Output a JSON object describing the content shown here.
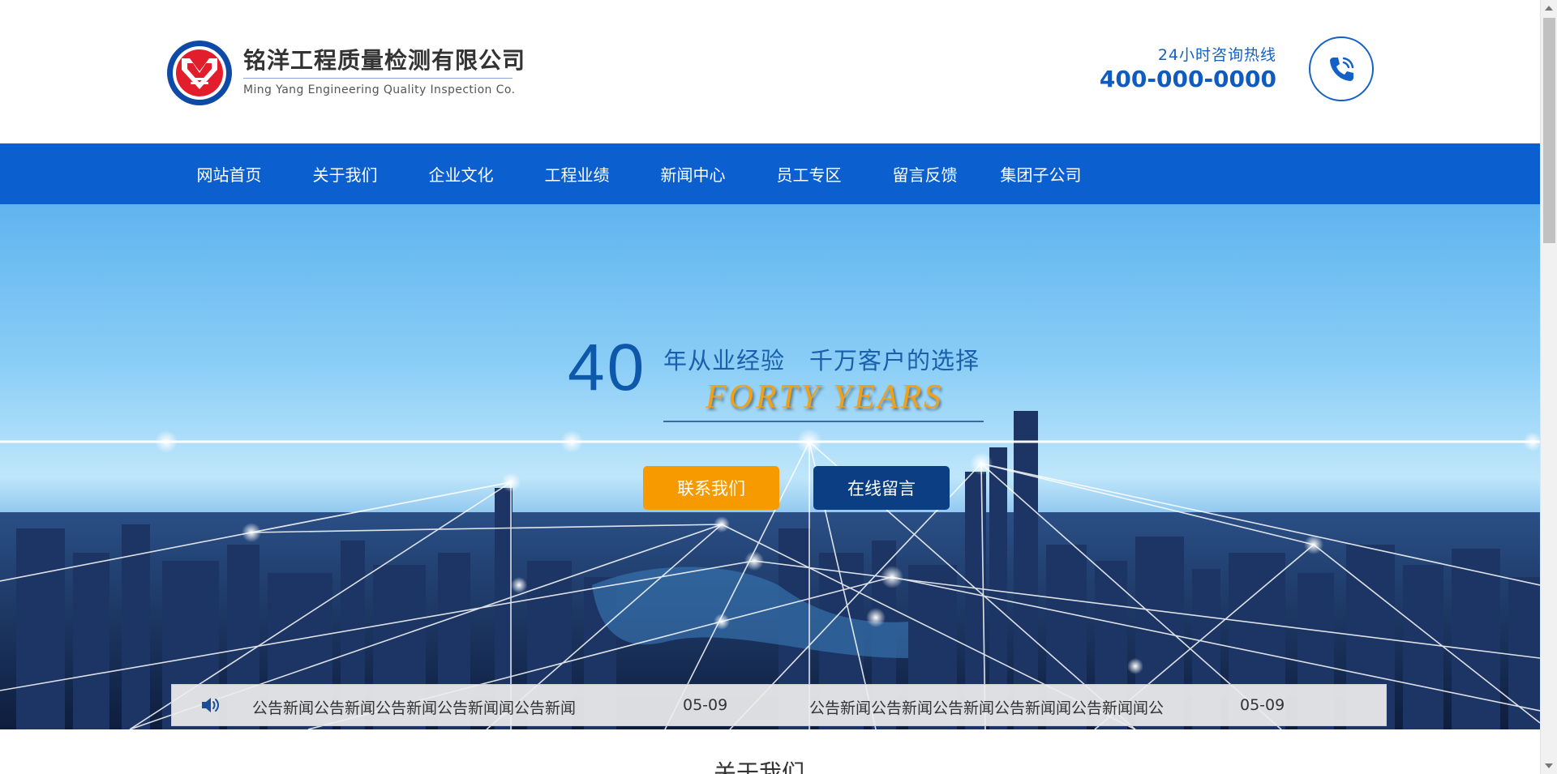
{
  "header": {
    "company_name": "铭洋工程质量检测有限公司",
    "company_name_en": "Ming Yang Engineering Quality Inspection Co.",
    "hotline_label": "24小时咨询热线",
    "hotline_number": "400-000-0000"
  },
  "nav": {
    "items": [
      {
        "label": "网站首页"
      },
      {
        "label": "关于我们"
      },
      {
        "label": "企业文化"
      },
      {
        "label": "工程业绩"
      },
      {
        "label": "新闻中心"
      },
      {
        "label": "员工专区"
      },
      {
        "label": "留言反馈"
      },
      {
        "label": "集团子公司"
      }
    ]
  },
  "hero": {
    "number": "40",
    "tagline": "年从业经验　千万客户的选择",
    "tagline_en": "FORTY  YEARS",
    "contact_button": "联系我们",
    "message_button": "在线留言"
  },
  "notice": {
    "items": [
      {
        "text": "公告新闻公告新闻公告新闻公告新闻闻公告新闻",
        "date": "05-09"
      },
      {
        "text": "公告新闻公告新闻公告新闻公告新闻闻公告新闻闻公",
        "date": "05-09"
      }
    ]
  },
  "section": {
    "title": "关于我们"
  },
  "colors": {
    "brand_blue": "#0c5fcf",
    "accent_orange": "#f79a00",
    "dark_navy": "#0b3e82"
  },
  "icons": {
    "phone": "phone-icon",
    "speaker": "speaker-icon"
  }
}
